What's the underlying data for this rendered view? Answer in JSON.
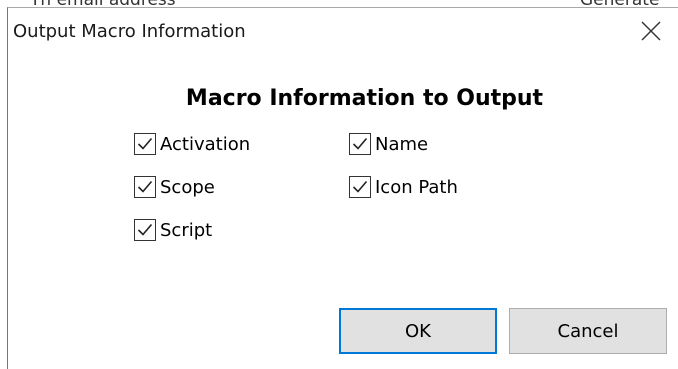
{
  "background_window": {
    "fragments": [
      "Th email address",
      "Generate"
    ]
  },
  "dialog": {
    "title": "Output Macro Information",
    "heading": "Macro Information to Output",
    "options": [
      {
        "label": "Activation",
        "checked": true
      },
      {
        "label": "Name",
        "checked": true
      },
      {
        "label": "Scope",
        "checked": true
      },
      {
        "label": "Icon Path",
        "checked": true
      },
      {
        "label": "Script",
        "checked": true
      }
    ],
    "buttons": {
      "ok_label": "OK",
      "cancel_label": "Cancel"
    },
    "colors": {
      "default_button_border": "#0078d7",
      "button_face": "#e1e1e1"
    }
  }
}
